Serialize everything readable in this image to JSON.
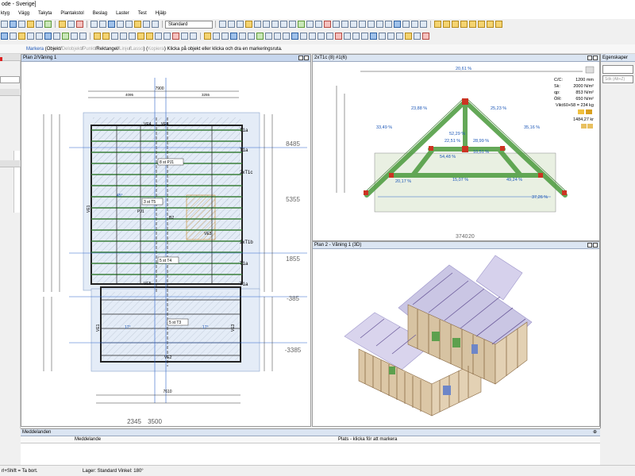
{
  "app": {
    "title": "ode - Sverige]"
  },
  "menu": [
    "ktyg",
    "Vägg",
    "Takyta",
    "Plantakstol",
    "Beslag",
    "Laster",
    "Test",
    "Hjälp"
  ],
  "toolbar": {
    "layer_combo": "Standard"
  },
  "markbar": {
    "action": "Markera",
    "segments": [
      "(",
      "Objekt",
      "/",
      "Delobjekt",
      "/",
      "Punkt",
      "/",
      "Rektangel",
      "/",
      "Linje",
      "/",
      "Lasso",
      ")",
      "(",
      "Kopiera",
      ")"
    ],
    "hint": "Klicka på objekt eller klicka och dra en markeringsruta."
  },
  "views": {
    "plan": {
      "title": "Plan 2/Våning 1",
      "dims": {
        "top_total": "7900",
        "top_a": "4095",
        "top_b": "3255",
        "bottom": "7610",
        "bottom_a": "2345",
        "bottom_b": "3500"
      },
      "levels": {
        "l1": "8485",
        "l2": "5355",
        "l3": "1855",
        "l4": "-385",
        "l5": "-3385"
      },
      "labels": {
        "t1a_1": "T1a",
        "t1a_2": "T1a",
        "t2x1c": "2xT1c",
        "t2x1b": "2xT1b",
        "t1a_3": "T1a",
        "t1a_4": "T1a",
        "ve4": "VE4",
        "ve6": "VE6",
        "ve1": "VE1",
        "ve5": "VE5",
        "ve2": "VE2",
        "ve3": "VE3",
        "ve1b": "VE1",
        "ve3b": "VE3",
        "pj1": "8 st PJ1",
        "t5": "3 st T5",
        "st4": "5 st T4",
        "st3": "5 st T3",
        "b2": "B2",
        "pj": "PJ1",
        "angle1": "45°",
        "angle2": "17°",
        "angle3": "17°"
      }
    },
    "truss": {
      "title": "2xT1c (8) #1(6)",
      "pcts": {
        "top": "20,61 %",
        "left_up": "23,88 %",
        "left_mid": "33,49 %",
        "right_up": "25,23 %",
        "right_mid": "35,16 %",
        "c1": "52,29 %",
        "c2": "22,51 %",
        "c3": "28,99 %",
        "c4": "54,48 %",
        "c5": "10,51 %",
        "c6": "20,17 %",
        "c7": "15,07 %",
        "c8": "49,24 %",
        "c9": "37,26 %"
      },
      "props": [
        {
          "k": "C/C:",
          "v": "1200 mm"
        },
        {
          "k": "Sk:",
          "v": "2000 N/m²"
        },
        {
          "k": "qp:",
          "v": "853 N/m²"
        },
        {
          "k": "ÖR:",
          "v": "650 N/m²"
        },
        {
          "k": "Vikt:",
          "v": "60+58 = 234 kg"
        }
      ],
      "price": "1484,27 kr",
      "dims": {
        "bottom": "3740",
        "bottom_b": "20"
      }
    },
    "model3d": {
      "title": "Plan 2 - Våning 1 (3D)"
    }
  },
  "properties": {
    "title": "Egenskaper",
    "search": "Sök (Alt+Z)"
  },
  "messages": {
    "title": "Meddelanden",
    "col1": "Meddelande",
    "col2": "Plats - klicka för att markera"
  },
  "status": {
    "left": "rl+Shift = Ta bort.",
    "right": "Lager: Standard  Vinkel: 180°"
  },
  "colors": {
    "accent": "#1b56b7",
    "truss_member": "#7cbf6b",
    "plan_grid": "#3a7f3a",
    "hatch": "#9aa7b9"
  }
}
